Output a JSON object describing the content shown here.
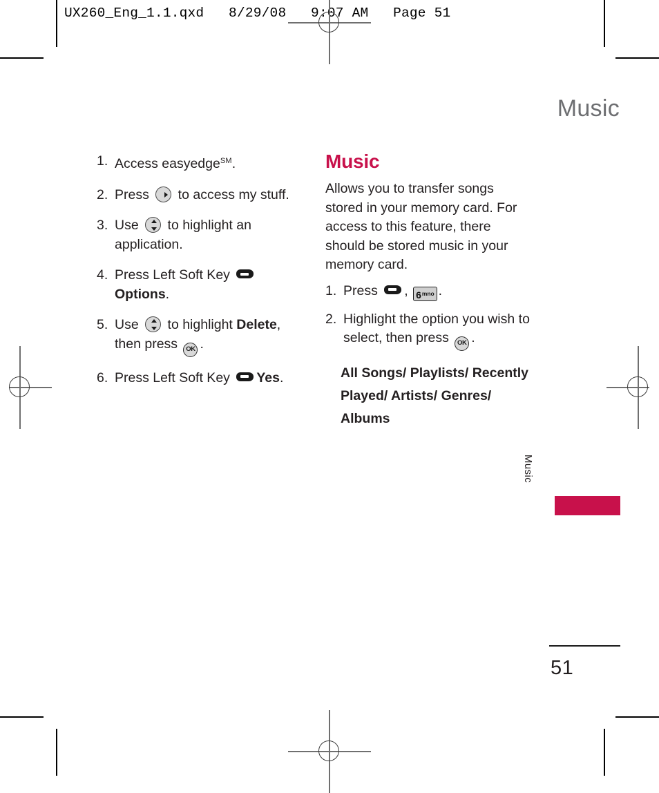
{
  "print_header": "UX260_Eng_1.1.qxd   8/29/08   9:07 AM   Page 51",
  "running_head": "Music",
  "left_column": {
    "steps": [
      {
        "num": "1.",
        "pre": "Access easyedge",
        "sup": "SM",
        "post": "."
      },
      {
        "num": "2.",
        "pre": "Press ",
        "icon": "nav-right-key-icon",
        "post": " to access my stuff."
      },
      {
        "num": "3.",
        "pre": "Use ",
        "icon": "nav-updown-key-icon",
        "post": " to highlight an application."
      },
      {
        "num": "4.",
        "pre": "Press Left Soft Key ",
        "icon": "left-soft-key-icon",
        "post": " ",
        "bold": "Options",
        "tail": "."
      },
      {
        "num": "5.",
        "pre": "Use ",
        "icon": "nav-updown-key-icon",
        "mid": " to highlight ",
        "bold": "Delete",
        "mid2": ", then press ",
        "icon2": "ok-key-icon",
        "tail": "."
      },
      {
        "num": "6.",
        "pre": "Press Left Soft Key ",
        "icon": "left-soft-key-icon",
        "post": " ",
        "bold": "Yes",
        "tail": "."
      }
    ]
  },
  "right_column": {
    "section_title": "Music",
    "description": "Allows you to transfer songs stored in your memory card. For access to this feature, there should be stored music in your memory card.",
    "steps": [
      {
        "num": "1.",
        "pre": "Press ",
        "icon": "left-soft-key-icon",
        "mid": ", ",
        "numkey_digit": "6",
        "numkey_letters": "mno",
        "tail": "."
      },
      {
        "num": "2.",
        "pre": "Highlight the option you wish to select, then press ",
        "icon": "ok-key-icon",
        "tail": "."
      }
    ],
    "options_list": "All Songs/ Playlists/ Recently Played/ Artists/ Genres/ Albums"
  },
  "side_tab": {
    "label": "Music"
  },
  "folio": {
    "page_number": "51"
  },
  "colors": {
    "accent": "#c8114b",
    "running_head": "#6d6e71",
    "body_text": "#231f20"
  }
}
